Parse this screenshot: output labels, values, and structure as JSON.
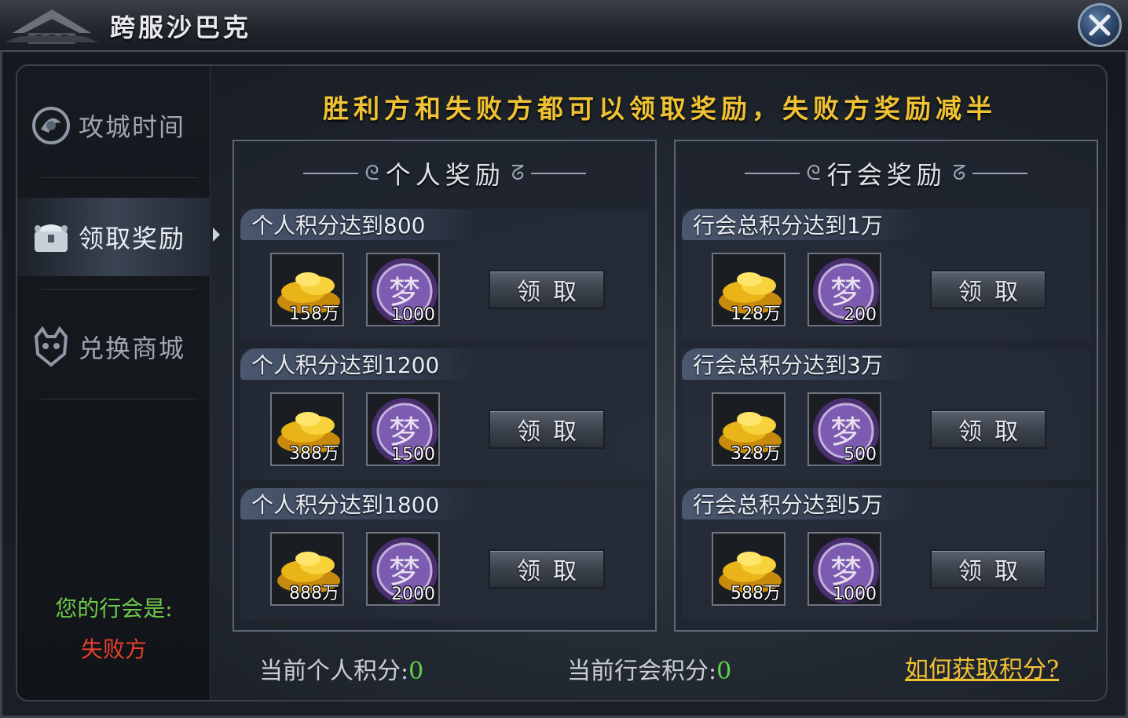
{
  "window": {
    "title": "跨服沙巴克"
  },
  "sidebar": {
    "items": [
      {
        "label": "攻城时间",
        "icon": "dragon-emblem-icon"
      },
      {
        "label": "领取奖励",
        "icon": "treasure-chest-icon",
        "active": true
      },
      {
        "label": "兑换商城",
        "icon": "demon-mask-icon"
      }
    ],
    "guild_label": "您的行会是:",
    "guild_value": "失败方"
  },
  "banner": "胜利方和失败方都可以领取奖励，失败方奖励减半",
  "personal": {
    "header": "个人奖励",
    "tiers": [
      {
        "title": "个人积分达到800",
        "gold": "158万",
        "dream": "1000",
        "button": "领取"
      },
      {
        "title": "个人积分达到1200",
        "gold": "388万",
        "dream": "1500",
        "button": "领取"
      },
      {
        "title": "个人积分达到1800",
        "gold": "888万",
        "dream": "2000",
        "button": "领取"
      }
    ]
  },
  "guild": {
    "header": "行会奖励",
    "tiers": [
      {
        "title": "行会总积分达到1万",
        "gold": "128万",
        "dream": "200",
        "button": "领取"
      },
      {
        "title": "行会总积分达到3万",
        "gold": "328万",
        "dream": "500",
        "button": "领取"
      },
      {
        "title": "行会总积分达到5万",
        "gold": "588万",
        "dream": "1000",
        "button": "领取"
      }
    ]
  },
  "footer": {
    "personal_label": "当前个人积分:",
    "personal_value": "0",
    "guild_label": "当前行会积分:",
    "guild_value": "0",
    "help_link": "如何获取积分?"
  },
  "item_glyph": "梦",
  "colors": {
    "banner_gold": "#f0c233",
    "score_green": "#5fd34c",
    "guild_green": "#6ec84b",
    "fail_red": "#e8412c"
  }
}
